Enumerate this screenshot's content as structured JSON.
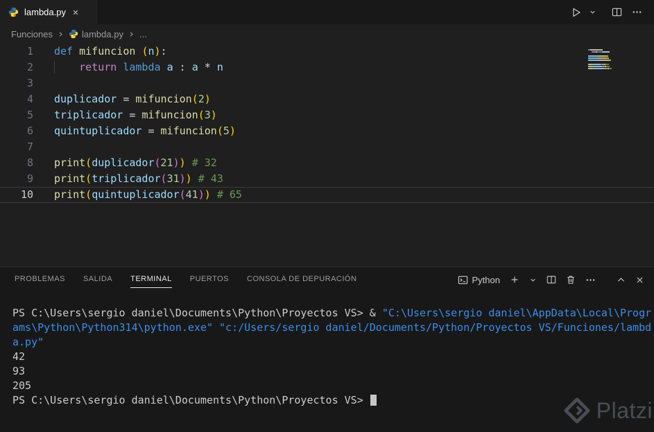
{
  "tab_bar": {
    "tab": {
      "title": "lambda.py"
    }
  },
  "breadcrumb": {
    "folder": "Funciones",
    "file": "lambda.py",
    "more": "..."
  },
  "editor": {
    "lines": [
      {
        "num": 1,
        "segments": [
          {
            "t": "def",
            "c": "k"
          },
          {
            "t": " ",
            "c": "p"
          },
          {
            "t": "mifuncion",
            "c": "f"
          },
          {
            "t": " ",
            "c": "p"
          },
          {
            "t": "(",
            "c": "b1"
          },
          {
            "t": "n",
            "c": "v"
          },
          {
            "t": ")",
            "c": "b1"
          },
          {
            "t": ":",
            "c": "p"
          }
        ]
      },
      {
        "num": 2,
        "segments": [
          {
            "t": "    ",
            "c": "ind"
          },
          {
            "t": "return",
            "c": "kc"
          },
          {
            "t": " ",
            "c": "p"
          },
          {
            "t": "lambda",
            "c": "k"
          },
          {
            "t": " ",
            "c": "p"
          },
          {
            "t": "a",
            "c": "v"
          },
          {
            "t": " : ",
            "c": "p"
          },
          {
            "t": "a",
            "c": "v"
          },
          {
            "t": " * ",
            "c": "p"
          },
          {
            "t": "n",
            "c": "v"
          }
        ]
      },
      {
        "num": 3,
        "segments": []
      },
      {
        "num": 4,
        "segments": [
          {
            "t": "duplicador",
            "c": "v"
          },
          {
            "t": " = ",
            "c": "p"
          },
          {
            "t": "mifuncion",
            "c": "f"
          },
          {
            "t": "(",
            "c": "b1"
          },
          {
            "t": "2",
            "c": "n"
          },
          {
            "t": ")",
            "c": "b1"
          }
        ]
      },
      {
        "num": 5,
        "segments": [
          {
            "t": "triplicador",
            "c": "v"
          },
          {
            "t": " = ",
            "c": "p"
          },
          {
            "t": "mifuncion",
            "c": "f"
          },
          {
            "t": "(",
            "c": "b1"
          },
          {
            "t": "3",
            "c": "n"
          },
          {
            "t": ")",
            "c": "b1"
          }
        ]
      },
      {
        "num": 6,
        "segments": [
          {
            "t": "quintuplicador",
            "c": "v"
          },
          {
            "t": " = ",
            "c": "p"
          },
          {
            "t": "mifuncion",
            "c": "f"
          },
          {
            "t": "(",
            "c": "b1"
          },
          {
            "t": "5",
            "c": "n"
          },
          {
            "t": ")",
            "c": "b1"
          }
        ]
      },
      {
        "num": 7,
        "segments": []
      },
      {
        "num": 8,
        "segments": [
          {
            "t": "print",
            "c": "f"
          },
          {
            "t": "(",
            "c": "b1"
          },
          {
            "t": "duplicador",
            "c": "v"
          },
          {
            "t": "(",
            "c": "b2"
          },
          {
            "t": "21",
            "c": "n"
          },
          {
            "t": ")",
            "c": "b2"
          },
          {
            "t": ")",
            "c": "b1"
          },
          {
            "t": " ",
            "c": "p"
          },
          {
            "t": "# 32",
            "c": "c"
          }
        ]
      },
      {
        "num": 9,
        "segments": [
          {
            "t": "print",
            "c": "f"
          },
          {
            "t": "(",
            "c": "b1"
          },
          {
            "t": "triplicador",
            "c": "v"
          },
          {
            "t": "(",
            "c": "b2"
          },
          {
            "t": "31",
            "c": "n"
          },
          {
            "t": ")",
            "c": "b2"
          },
          {
            "t": ")",
            "c": "b1"
          },
          {
            "t": " ",
            "c": "p"
          },
          {
            "t": "# 43",
            "c": "c"
          }
        ]
      },
      {
        "num": 10,
        "current": true,
        "segments": [
          {
            "t": "print",
            "c": "f"
          },
          {
            "t": "(",
            "c": "b1"
          },
          {
            "t": "quintuplicador",
            "c": "v"
          },
          {
            "t": "(",
            "c": "b2"
          },
          {
            "t": "41",
            "c": "n"
          },
          {
            "t": ")",
            "c": "b2"
          },
          {
            "t": ")",
            "c": "b1"
          },
          {
            "t": " ",
            "c": "p"
          },
          {
            "t": "# 65",
            "c": "c"
          }
        ]
      }
    ],
    "token_colors": {
      "keyword": "#569CD6",
      "control_keyword": "#C586C0",
      "function": "#DCDCAA",
      "variable": "#9CDCFE",
      "number": "#B5CEA8",
      "comment": "#6A9955",
      "default": "#D4D4D4",
      "bracket_level_1": "#FFD700",
      "bracket_level_2": "#DA70D6"
    }
  },
  "panel": {
    "tabs": [
      {
        "label": "PROBLEMAS",
        "active": false
      },
      {
        "label": "SALIDA",
        "active": false
      },
      {
        "label": "TERMINAL",
        "active": true
      },
      {
        "label": "PUERTOS",
        "active": false
      },
      {
        "label": "CONSOLA DE DEPURACIÓN",
        "active": false
      }
    ],
    "toolbar": {
      "profile_label": "Python"
    },
    "terminal": {
      "foreground": "#CCCCCC",
      "string_color": "#3B8EEA",
      "lines": [
        {
          "segments": [
            {
              "t": "PS C:\\Users\\sergio daniel\\Documents\\Python\\Proyectos VS> ",
              "c": "t"
            },
            {
              "t": "& ",
              "c": "t"
            },
            {
              "t": "\"C:\\Users\\sergio daniel\\AppData\\Local\\Progr",
              "c": "ts"
            }
          ]
        },
        {
          "segments": [
            {
              "t": "ams\\Python\\Python314\\python.exe\" ",
              "c": "ts"
            },
            {
              "t": "\"c:/Users/sergio daniel/Documents/Python/Proyectos VS/Funciones/lambd",
              "c": "ts"
            }
          ]
        },
        {
          "segments": [
            {
              "t": "a.py\"",
              "c": "ts"
            }
          ]
        },
        {
          "segments": [
            {
              "t": "42",
              "c": "t"
            }
          ]
        },
        {
          "segments": [
            {
              "t": "93",
              "c": "t"
            }
          ]
        },
        {
          "segments": [
            {
              "t": "205",
              "c": "t"
            }
          ]
        },
        {
          "segments": [
            {
              "t": "PS C:\\Users\\sergio daniel\\Documents\\Python\\Proyectos VS> ",
              "c": "t"
            }
          ],
          "cursor": true
        }
      ]
    }
  },
  "watermark": {
    "text": "Platzi"
  }
}
